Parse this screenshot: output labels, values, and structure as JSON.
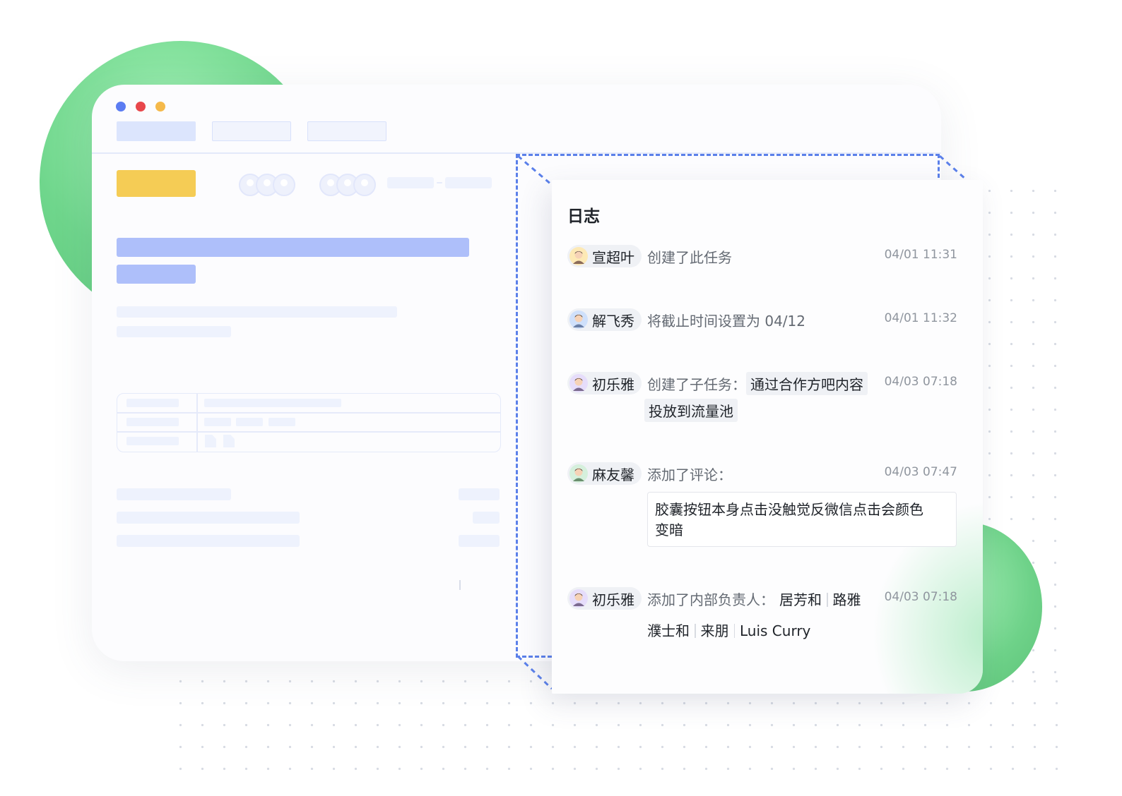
{
  "log_panel": {
    "title": "日志",
    "entries": [
      {
        "user": "宣超叶",
        "action": "创建了此任务",
        "time": "04/01 11:31"
      },
      {
        "user": "解飞秀",
        "action": "将截止时间设置为 04/12",
        "time": "04/01 11:32"
      },
      {
        "user": "初乐雅",
        "action": "创建了子任务：",
        "subtask_line1": "通过合作方吧内容",
        "subtask_line2": "投放到流量池",
        "time": "04/03 07:18"
      },
      {
        "user": "麻友馨",
        "action": "添加了评论：",
        "comment_line1": "胶囊按钮本身点击没触觉反微信点击会颜色",
        "comment_line2": "变暗",
        "time": "04/03 07:47"
      },
      {
        "user": "初乐雅",
        "action": "添加了内部负责人：",
        "assignees": [
          "居芳和",
          "路雅",
          "濮士和",
          "来朋",
          "Luis Curry"
        ],
        "time": "04/03 07:18"
      }
    ]
  },
  "icons": {
    "traffic_lights": [
      "window-close-dot",
      "window-minimize-dot",
      "window-zoom-dot"
    ],
    "avatar": "user-avatar-icon"
  },
  "colors": {
    "accent_blue": "#5b80ea",
    "placeholder_blue": "#aebffa",
    "yellow": "#f5cc55",
    "green": "#6fd68c"
  }
}
